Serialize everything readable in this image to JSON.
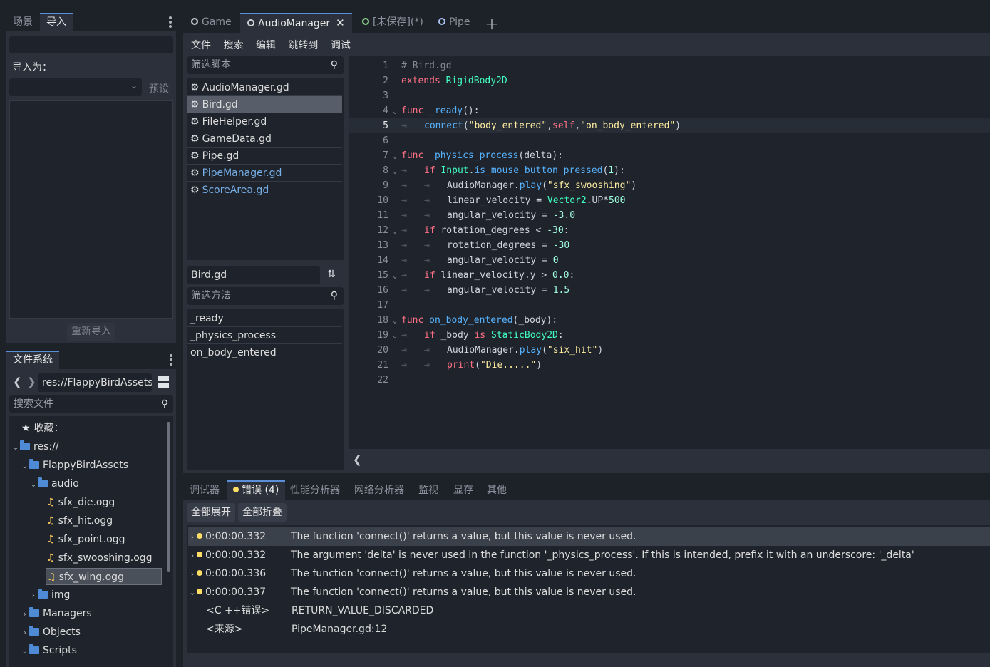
{
  "left_dock": {
    "tabs": [
      "场景",
      "导入"
    ],
    "import_as_label": "导入为：",
    "preset_label": "预设",
    "reimport_label": "重新导入"
  },
  "filesystem": {
    "tab": "文件系统",
    "path": "res://FlappyBirdAssets",
    "search_placeholder": "搜索文件",
    "favorites": "收藏：",
    "tree": [
      {
        "label": "res://"
      },
      {
        "label": "FlappyBirdAssets"
      },
      {
        "label": "audio"
      },
      {
        "label": "sfx_die.ogg"
      },
      {
        "label": "sfx_hit.ogg"
      },
      {
        "label": "sfx_point.ogg"
      },
      {
        "label": "sfx_swooshing.ogg"
      },
      {
        "label": "sfx_wing.ogg"
      },
      {
        "label": "img"
      },
      {
        "label": "Managers"
      },
      {
        "label": "Objects"
      },
      {
        "label": "Scripts"
      }
    ]
  },
  "script_tabs": [
    "Game",
    "AudioManager",
    "[未保存](*)",
    "Pipe"
  ],
  "menu": [
    "文件",
    "搜索",
    "编辑",
    "跳转到",
    "调试"
  ],
  "script_filter_placeholder": "筛选脚本",
  "scripts": [
    "AudioManager.gd",
    "Bird.gd",
    "FileHelper.gd",
    "GameData.gd",
    "Pipe.gd",
    "PipeManager.gd",
    "ScoreArea.gd"
  ],
  "current_script": "Bird.gd",
  "method_filter_placeholder": "筛选方法",
  "methods": [
    "_ready",
    "_physics_process",
    "on_body_entered"
  ],
  "code": {
    "line_numbers": [
      "1",
      "2",
      "3",
      "4",
      "5",
      "6",
      "7",
      "8",
      "9",
      "10",
      "11",
      "12",
      "13",
      "14",
      "15",
      "16",
      "17",
      "18",
      "19",
      "20",
      "21",
      "22"
    ]
  },
  "debugger": {
    "tabs": [
      "调试器",
      "错误 (4)",
      "性能分析器",
      "网络分析器",
      "监视",
      "显存",
      "其他"
    ],
    "expand_all": "全部展开",
    "collapse_all": "全部折叠",
    "errors": [
      {
        "time": "0:00:00.332",
        "message": "The function 'connect()' returns a value, but this value is never used."
      },
      {
        "time": "0:00:00.332",
        "message": "The argument 'delta' is never used in the function '_physics_process'. If this is intended, prefix it with an underscore: '_delta'"
      },
      {
        "time": "0:00:00.336",
        "message": "The function 'connect()' returns a value, but this value is never used."
      },
      {
        "time": "0:00:00.337",
        "message": "The function 'connect()' returns a value, but this value is never used."
      }
    ],
    "details": [
      {
        "key": "<C ++错误>",
        "value": "RETURN_VALUE_DISCARDED"
      },
      {
        "key": "<来源>",
        "value": "PipeManager.gd:12"
      }
    ]
  }
}
